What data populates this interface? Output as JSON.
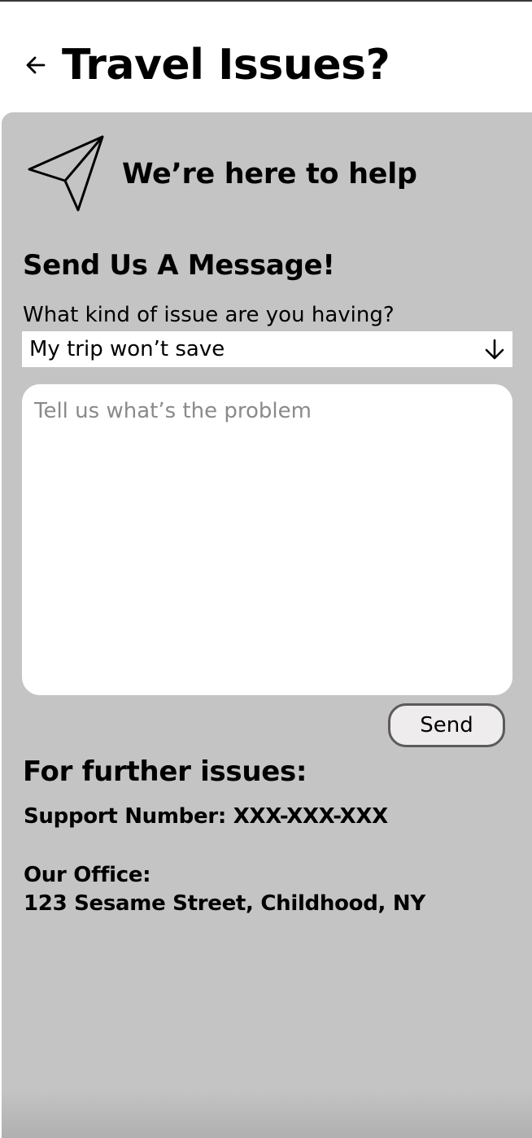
{
  "header": {
    "title": "Travel Issues?",
    "back_icon": "arrow-left-icon"
  },
  "hero": {
    "icon": "paper-plane-icon",
    "text": "We’re here to help"
  },
  "form": {
    "title": "Send Us A Message!",
    "issue_label": "What kind of issue are you having?",
    "issue_selected": "My trip won’t save",
    "dropdown_icon": "arrow-down-icon",
    "message_value": "",
    "message_placeholder": "Tell us what’s the problem",
    "send_label": "Send"
  },
  "contact": {
    "title": "For further issues:",
    "support_number": "Support Number: XXX-XXX-XXX",
    "office_label": "Our Office:",
    "office_address": "123 Sesame Street, Childhood, NY"
  },
  "colors": {
    "panel_background": "#c4c4c4",
    "field_background": "#ffffff",
    "button_background": "#eeecec",
    "button_border": "#5b5b5b",
    "placeholder_text": "#8a8a8a"
  }
}
